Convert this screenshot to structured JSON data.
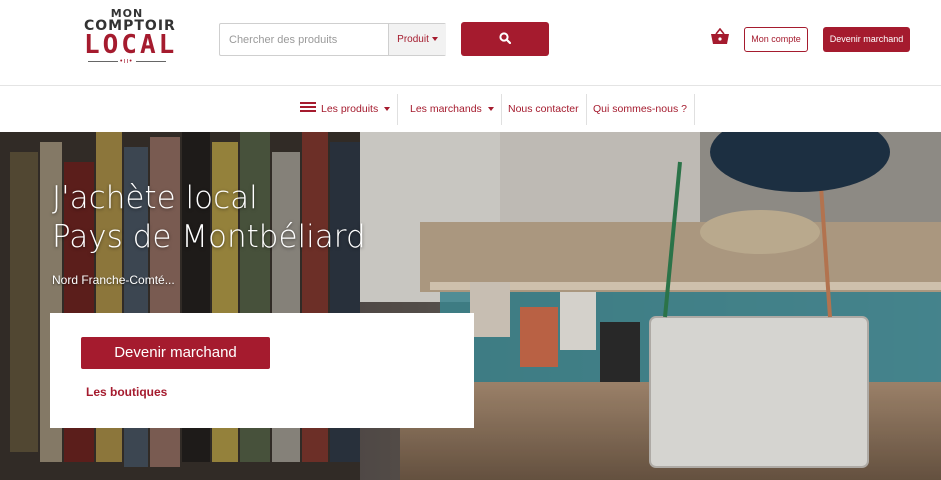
{
  "logo": {
    "line1": "MON",
    "line2": "COMPTOIR",
    "line3": "LOCAL",
    "dots": "•ıı•"
  },
  "search": {
    "placeholder": "Chercher des produits",
    "value": "",
    "category_label": "Produit",
    "button_icon": "search-icon"
  },
  "header": {
    "basket_icon": "basket-icon",
    "account_label": "Mon compte",
    "merchant_label": "Devenir marchand"
  },
  "nav": {
    "items": [
      {
        "label": "Les produits",
        "icon": "menu-icon",
        "dropdown": true
      },
      {
        "label": "Les marchands",
        "dropdown": true
      },
      {
        "label": "Nous contacter",
        "dropdown": false
      },
      {
        "label": "Qui sommes-nous ?",
        "dropdown": false
      }
    ]
  },
  "hero": {
    "title_line1": "J'achète local",
    "title_line2": "Pays de Montbéliard",
    "subtitle": "Nord Franche-Comté...",
    "cta_label": "Devenir marchand",
    "link_label": "Les boutiques"
  },
  "colors": {
    "accent": "#a51b2e",
    "text": "#333333",
    "border": "#e4e4e4"
  }
}
